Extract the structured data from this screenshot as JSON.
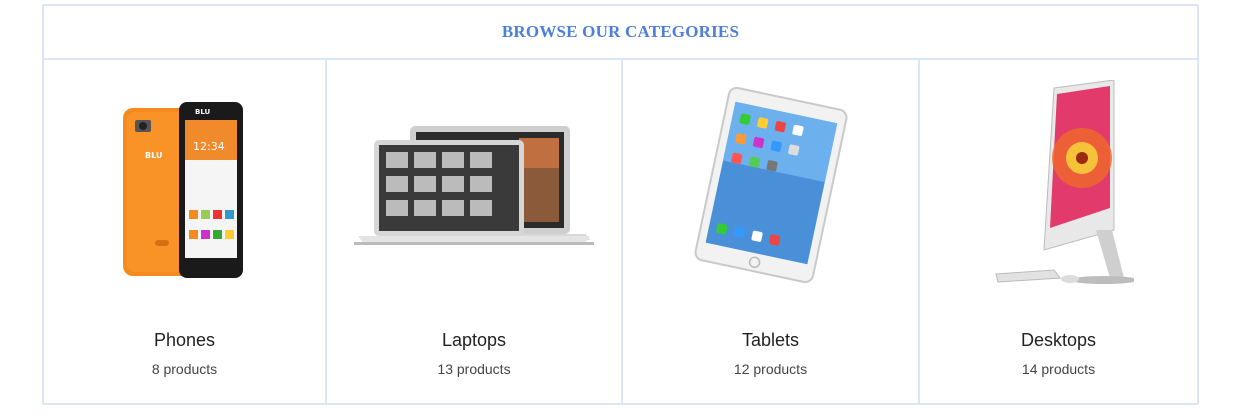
{
  "header": {
    "title": "BROWSE OUR CATEGORIES"
  },
  "categories": [
    {
      "name": "Phones",
      "count": "8 products",
      "image": "phone-image",
      "brand_text": "BLU",
      "screen_time": "12:34"
    },
    {
      "name": "Laptops",
      "count": "13 products",
      "image": "laptop-image"
    },
    {
      "name": "Tablets",
      "count": "12 products",
      "image": "tablet-image"
    },
    {
      "name": "Desktops",
      "count": "14 products",
      "image": "desktop-image"
    }
  ],
  "colors": {
    "title": "#4c7fd9",
    "border": "#dbe6f5",
    "phone_orange": "#f58a1f"
  }
}
